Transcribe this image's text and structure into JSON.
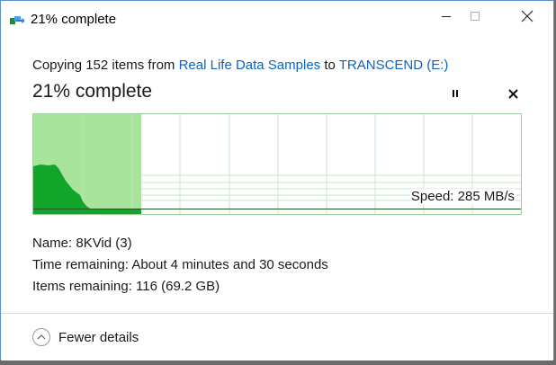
{
  "window": {
    "title": "21% complete",
    "controls": {
      "minimize": "minimize-icon",
      "maximize": "maximize-icon",
      "close": "close-icon"
    }
  },
  "copy": {
    "prefix": "Copying 152 items from ",
    "source": "Real Life Data Samples",
    "middle": " to ",
    "destination": "TRANSCEND (E:)",
    "heading": "21% complete",
    "progress_fraction": 0.21
  },
  "graph": {
    "speed_text": "Speed: 285 MB/s",
    "colors": {
      "fill": "#a8e49c",
      "speed_area": "#11a52a",
      "grid": "#bfe3bf",
      "border": "#9ad19a"
    }
  },
  "details": {
    "name": "Name:  8KVid (3)",
    "time_remaining": "Time remaining:  About 4 minutes and 30 seconds",
    "items_remaining": "Items remaining:  116 (69.2 GB)"
  },
  "footer": {
    "toggle_label": "Fewer details",
    "toggle_icon": "chevron-up-icon"
  },
  "colors": {
    "link": "#0b64c6",
    "accent_border": "#5a8fd6"
  }
}
